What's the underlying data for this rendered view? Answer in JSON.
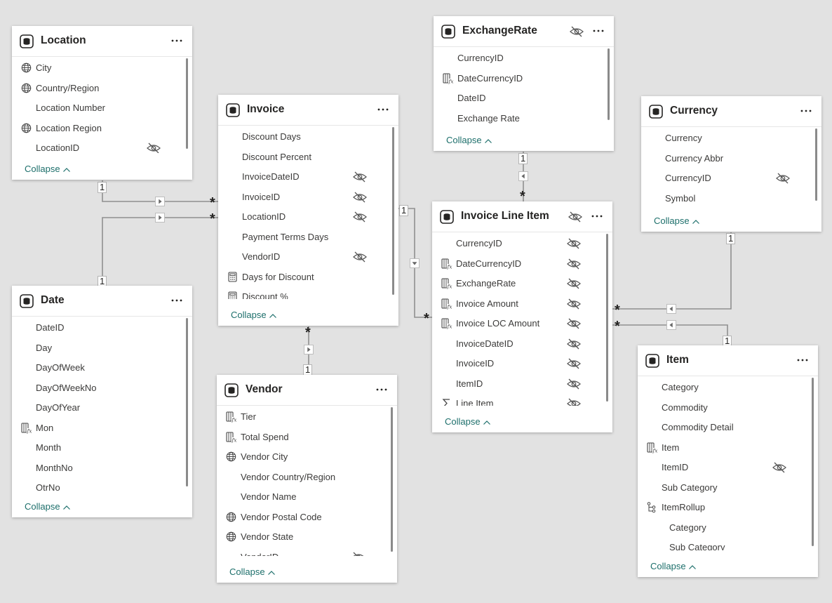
{
  "tables": {
    "location": {
      "title": "Location",
      "fields": [
        "City",
        "Country/Region",
        "Location Number",
        "Location Region",
        "LocationID"
      ],
      "icons": [
        "globe-icon",
        "globe-icon",
        "",
        "globe-icon",
        ""
      ],
      "hidden": [
        false,
        false,
        false,
        false,
        true
      ],
      "collapse": "Collapse"
    },
    "invoice": {
      "title": "Invoice",
      "fields": [
        "Discount Days",
        "Discount Percent",
        "InvoiceDateID",
        "InvoiceID",
        "LocationID",
        "Payment Terms Days",
        "VendorID",
        "Days for Discount",
        "Discount %"
      ],
      "icons": [
        "",
        "",
        "",
        "",
        "",
        "",
        "",
        "calculator-icon",
        "calculator-icon"
      ],
      "hidden": [
        false,
        false,
        true,
        true,
        true,
        false,
        true,
        false,
        false
      ],
      "collapse": "Collapse"
    },
    "exchangerate": {
      "title": "ExchangeRate",
      "fields": [
        "CurrencyID",
        "DateCurrencyID",
        "DateID",
        "Exchange Rate"
      ],
      "icons": [
        "",
        "calculated-column-icon",
        "",
        ""
      ],
      "hidden": [
        false,
        false,
        false,
        false
      ],
      "title_hidden": true,
      "collapse": "Collapse"
    },
    "currency": {
      "title": "Currency",
      "fields": [
        "Currency",
        "Currency Abbr",
        "CurrencyID",
        "Symbol"
      ],
      "icons": [
        "",
        "",
        "",
        ""
      ],
      "hidden": [
        false,
        false,
        true,
        false
      ],
      "collapse": "Collapse"
    },
    "invoicelineitem": {
      "title": "Invoice Line Item",
      "fields": [
        "CurrencyID",
        "DateCurrencyID",
        "ExchangeRate",
        "Invoice Amount",
        "Invoice LOC Amount",
        "InvoiceDateID",
        "InvoiceID",
        "ItemID",
        "Line Item"
      ],
      "icons": [
        "",
        "calculated-column-icon",
        "calculated-column-icon",
        "calculated-column-icon",
        "calculated-column-icon",
        "",
        "",
        "",
        "sigma-icon"
      ],
      "hidden": [
        true,
        true,
        true,
        true,
        true,
        true,
        true,
        true,
        true
      ],
      "title_hidden": true,
      "collapse": "Collapse"
    },
    "date": {
      "title": "Date",
      "fields": [
        "DateID",
        "Day",
        "DayOfWeek",
        "DayOfWeekNo",
        "DayOfYear",
        "Mon",
        "Month",
        "MonthNo",
        "QtrNo"
      ],
      "icons": [
        "",
        "",
        "",
        "",
        "",
        "calculated-column-icon",
        "",
        "",
        ""
      ],
      "hidden": [
        false,
        false,
        false,
        false,
        false,
        false,
        false,
        false,
        false
      ],
      "collapse": "Collapse"
    },
    "vendor": {
      "title": "Vendor",
      "fields": [
        "Tier",
        "Total Spend",
        "Vendor City",
        "Vendor Country/Region",
        "Vendor Name",
        "Vendor Postal Code",
        "Vendor State",
        "VendorID"
      ],
      "icons": [
        "calculated-column-icon",
        "calculated-column-icon",
        "globe-icon",
        "",
        "",
        "globe-icon",
        "globe-icon",
        ""
      ],
      "hidden": [
        false,
        false,
        false,
        false,
        false,
        false,
        false,
        true
      ],
      "collapse": "Collapse"
    },
    "item": {
      "title": "Item",
      "fields": [
        "Category",
        "Commodity",
        "Commodity Detail",
        "Item",
        "ItemID",
        "Sub Category",
        "ItemRollup",
        "Category",
        "Sub Category"
      ],
      "icons": [
        "",
        "",
        "",
        "calculated-column-icon",
        "",
        "",
        "hierarchy-icon",
        "",
        ""
      ],
      "indent": [
        false,
        false,
        false,
        false,
        false,
        false,
        false,
        true,
        true
      ],
      "hidden": [
        false,
        false,
        false,
        false,
        true,
        false,
        false,
        false,
        false
      ],
      "collapse": "Collapse"
    }
  },
  "cardinality": {
    "one": "1",
    "many": "*"
  }
}
